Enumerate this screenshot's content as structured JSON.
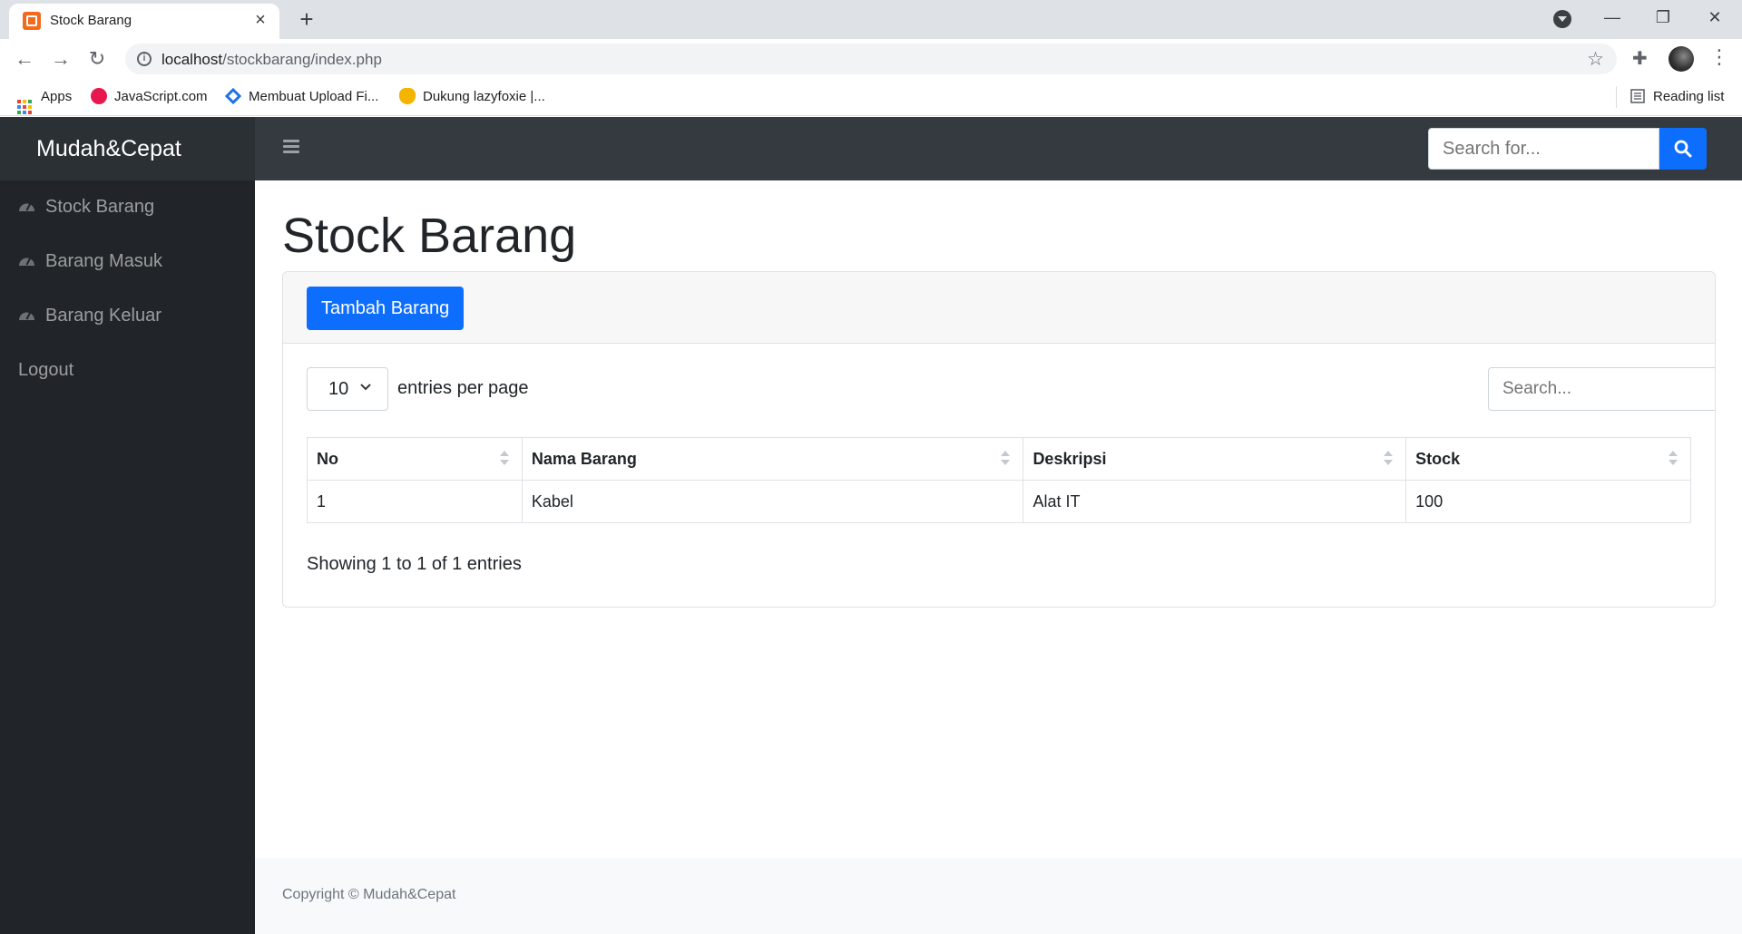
{
  "browser": {
    "tab_title": "Stock Barang",
    "url_host": "localhost",
    "url_path": "/stockbarang/index.php",
    "bookmarks": [
      {
        "label": "Apps",
        "icon": "apps-grid-icon"
      },
      {
        "label": "JavaScript.com",
        "icon": "javascript-icon"
      },
      {
        "label": "Membuat Upload Fi...",
        "icon": "code-diamond-icon"
      },
      {
        "label": "Dukung lazyfoxie |...",
        "icon": "fox-icon"
      }
    ],
    "reading_list": "Reading list"
  },
  "app": {
    "brand": "Mudah&Cepat",
    "search_placeholder": "Search for...",
    "sidebar": [
      {
        "label": "Stock Barang",
        "icon": "tachometer-icon"
      },
      {
        "label": "Barang Masuk",
        "icon": "tachometer-icon"
      },
      {
        "label": "Barang Keluar",
        "icon": "tachometer-icon"
      },
      {
        "label": "Logout",
        "icon": ""
      }
    ],
    "page_title": "Stock Barang",
    "add_button": "Tambah Barang",
    "per_page_value": "10",
    "per_page_label": "entries per page",
    "table_search_placeholder": "Search...",
    "table": {
      "columns": [
        "No",
        "Nama Barang",
        "Deskripsi",
        "Stock"
      ],
      "rows": [
        [
          "1",
          "Kabel",
          "Alat IT",
          "100"
        ]
      ]
    },
    "info": "Showing 1 to 1 of 1 entries",
    "footer": "Copyright © Mudah&Cepat",
    "colors": {
      "primary": "#0d6efd",
      "topnav": "#343a40",
      "sidebar": "#212529"
    }
  }
}
